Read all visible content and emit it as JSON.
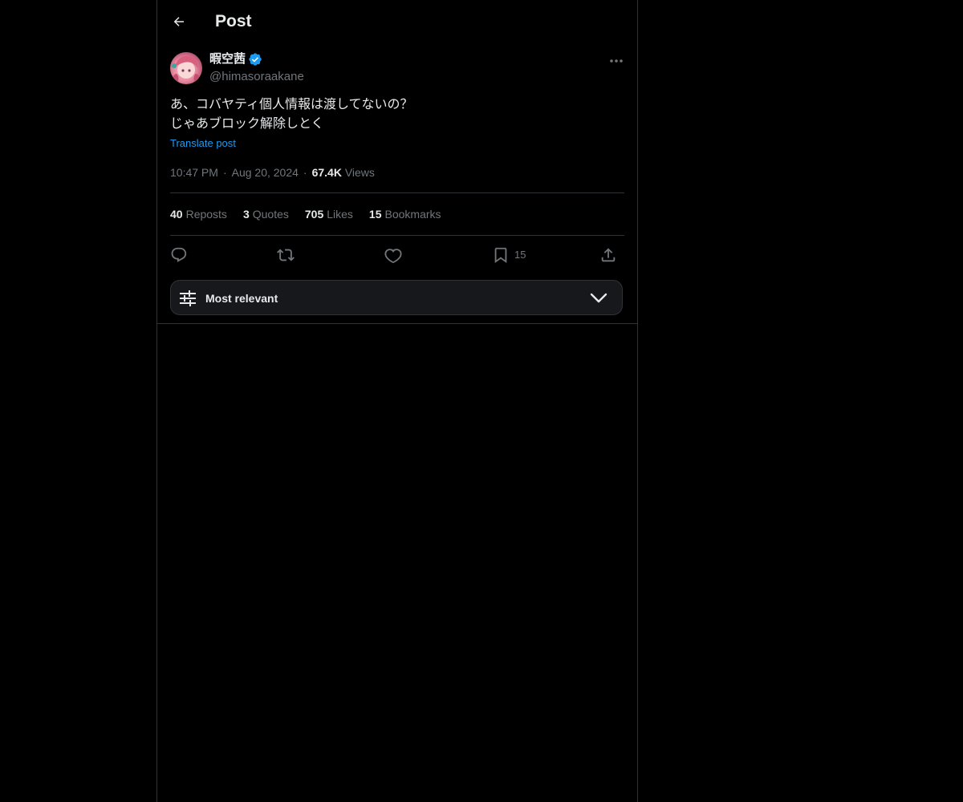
{
  "header": {
    "title": "Post",
    "back_icon": "arrow-left-icon"
  },
  "author": {
    "display_name": "暇空茜",
    "handle": "@himasoraakane",
    "verified_icon": "verified-badge-icon",
    "verified_color": "#1d9bf0"
  },
  "post": {
    "text": "あ、コバヤティ個人情報は渡してないの？\nじゃあブロック解除しとく",
    "translate_label": "Translate post",
    "time": "10:47 PM",
    "date": "Aug 20, 2024",
    "views_count": "67.4K",
    "views_label": "Views"
  },
  "stats": [
    {
      "count": "40",
      "label": "Reposts"
    },
    {
      "count": "3",
      "label": "Quotes"
    },
    {
      "count": "705",
      "label": "Likes"
    },
    {
      "count": "15",
      "label": "Bookmarks"
    }
  ],
  "actions": {
    "reply_icon": "reply-icon",
    "repost_icon": "repost-icon",
    "like_icon": "heart-icon",
    "bookmark_icon": "bookmark-icon",
    "bookmark_count": "15",
    "share_icon": "share-icon"
  },
  "sort": {
    "label": "Most relevant",
    "icon": "sliders-icon",
    "chevron": "chevron-down-icon"
  },
  "colors": {
    "background": "#000000",
    "text_primary": "#e7e9ea",
    "text_secondary": "#71767b",
    "accent": "#1d9bf0",
    "border": "#2f3336"
  }
}
